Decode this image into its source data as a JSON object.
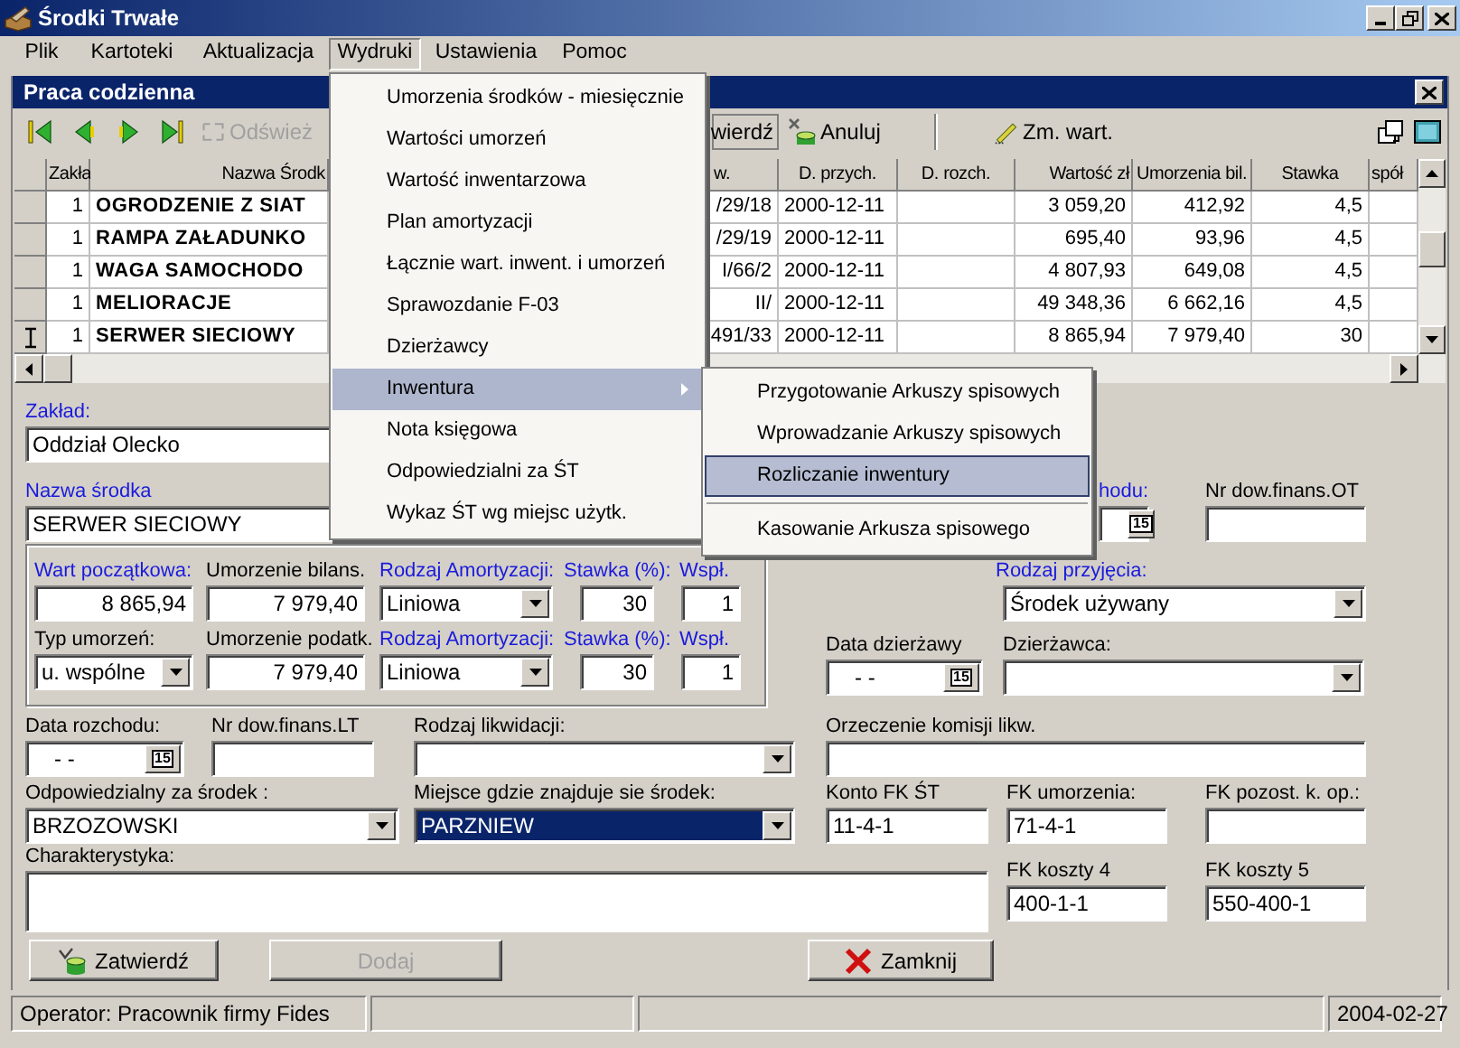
{
  "window": {
    "title": "Środki Trwałe"
  },
  "menu_bar": [
    {
      "label": "Plik",
      "selected": false
    },
    {
      "label": "Kartoteki",
      "selected": false
    },
    {
      "label": "Aktualizacja",
      "selected": false
    },
    {
      "label": "Wydruki",
      "selected": true
    },
    {
      "label": "Ustawienia",
      "selected": false
    },
    {
      "label": "Pomoc",
      "selected": false
    }
  ],
  "dropdown_menu": {
    "items": [
      {
        "label": "Umorzenia środków - miesięcznie",
        "selected": false,
        "has_submenu": false
      },
      {
        "label": "Wartości umorzeń",
        "selected": false,
        "has_submenu": false
      },
      {
        "label": "Wartość inwentarzowa",
        "selected": false,
        "has_submenu": false
      },
      {
        "label": "Plan amortyzacji",
        "selected": false,
        "has_submenu": false
      },
      {
        "label": "Łącznie wart. inwent. i umorzeń",
        "selected": false,
        "has_submenu": false
      },
      {
        "label": "Sprawozdanie F-03",
        "selected": false,
        "has_submenu": false
      },
      {
        "label": "Dzierżawcy",
        "selected": false,
        "has_submenu": false
      },
      {
        "label": "Inwentura",
        "selected": true,
        "has_submenu": true
      },
      {
        "label": "Nota księgowa",
        "selected": false,
        "has_submenu": false
      },
      {
        "label": "Odpowiedzialni za ŚT",
        "selected": false,
        "has_submenu": false
      },
      {
        "label": "Wykaz ŚT wg miejsc użytk.",
        "selected": false,
        "has_submenu": false
      }
    ]
  },
  "submenu": {
    "items": [
      {
        "kind": "item",
        "label": "Przygotowanie Arkuszy spisowych",
        "selected": false
      },
      {
        "kind": "item",
        "label": "Wprowadzanie Arkuszy spisowych",
        "selected": false
      },
      {
        "kind": "item",
        "label": "Rozliczanie inwentury",
        "selected": true
      },
      {
        "kind": "separator"
      },
      {
        "kind": "item",
        "label": "Kasowanie Arkusza spisowego",
        "selected": false
      }
    ]
  },
  "child_window": {
    "title": "Praca codzienna"
  },
  "toolbar": [
    {
      "kind": "refresh",
      "label": "Odśwież",
      "disabled": true
    },
    {
      "kind": "confirm",
      "label": "wierdź",
      "disabled": false
    },
    {
      "kind": "cancel",
      "label": "Anuluj",
      "disabled": false
    },
    {
      "kind": "edit",
      "label": "Zm. wart.",
      "disabled": false
    }
  ],
  "table": {
    "columns": [
      {
        "label": "Zakła"
      },
      {
        "label": "Nazwa Środk"
      },
      {
        "label": "w."
      },
      {
        "label": "D. przych."
      },
      {
        "label": "D. rozch."
      },
      {
        "label": "Wartość zł"
      },
      {
        "label": "Umorzenia bil."
      },
      {
        "label": "Stawka"
      },
      {
        "label": "spół"
      }
    ],
    "rows": [
      {
        "current": false,
        "zakl": "1",
        "nazwa": "OGRODZENIE Z SIAT",
        "nr": "/29/18",
        "d_przych": "2000-12-11",
        "wartosc": "3 059,20",
        "umorzenia": "412,92",
        "stawka": "4,5"
      },
      {
        "current": false,
        "zakl": "1",
        "nazwa": "RAMPA ZAŁADUNKO",
        "nr": "/29/19",
        "d_przych": "2000-12-11",
        "wartosc": "695,40",
        "umorzenia": "93,96",
        "stawka": "4,5"
      },
      {
        "current": false,
        "zakl": "1",
        "nazwa": "WAGA SAMOCHODO",
        "nr": "I/66/2",
        "d_przych": "2000-12-11",
        "wartosc": "4 807,93",
        "umorzenia": "649,08",
        "stawka": "4,5"
      },
      {
        "current": false,
        "zakl": "1",
        "nazwa": "MELIORACJE",
        "nr": "II/",
        "d_przych": "2000-12-11",
        "wartosc": "49 348,36",
        "umorzenia": "6 662,16",
        "stawka": "4,5"
      },
      {
        "current": true,
        "zakl": "1",
        "nazwa": "SERWER SIECIOWY",
        "nr": "491/33",
        "d_przych": "2000-12-11",
        "wartosc": "8 865,94",
        "umorzenia": "7 979,40",
        "stawka": "30"
      }
    ]
  },
  "form": {
    "zaklad": {
      "kind": "text",
      "label": "Zakład:",
      "required": true,
      "value": "Oddział Olecko"
    },
    "nazwa_srodka": {
      "kind": "text",
      "label": "Nazwa środka",
      "required": true,
      "value": "SERWER SIECIOWY"
    },
    "field_hodu": {
      "kind": "date",
      "label": "hodu:",
      "required": true,
      "button": "15"
    },
    "nr_dow_finans_ot": {
      "kind": "text",
      "label": "Nr dow.finans.OT",
      "required": false
    },
    "wart_poczatkowa": {
      "kind": "number",
      "label": "Wart początkowa:",
      "required": true,
      "value": "8 865,94"
    },
    "umorzenie_bilans": {
      "kind": "number",
      "label": "Umorzenie bilans.",
      "required": false,
      "value": "7 979,40"
    },
    "rodzaj_amortyzacji_1": {
      "kind": "combo",
      "label": "Rodzaj Amortyzacji:",
      "required": true,
      "value": "Liniowa",
      "focused": false
    },
    "stawka_1": {
      "kind": "number",
      "label": "Stawka (%):",
      "required": true,
      "value": "30"
    },
    "wspl_1": {
      "kind": "number",
      "label": "Wspł.",
      "required": true,
      "value": "1"
    },
    "typ_umorzen": {
      "kind": "combo",
      "label": "Typ umorzeń:",
      "required": false,
      "value": "u. wspólne",
      "focused": false
    },
    "umorzenie_podatk": {
      "kind": "number",
      "label": "Umorzenie podatk.",
      "required": false,
      "value": "7 979,40"
    },
    "rodzaj_amortyzacji_2": {
      "kind": "combo",
      "label": "Rodzaj Amortyzacji:",
      "required": true,
      "value": "Liniowa",
      "focused": false
    },
    "stawka_2": {
      "kind": "number",
      "label": "Stawka (%):",
      "required": true,
      "value": "30"
    },
    "wspl_2": {
      "kind": "number",
      "label": "Wspł.",
      "required": true,
      "value": "1"
    },
    "rodzaj_przyjecia": {
      "kind": "combo",
      "label": "Rodzaj przyjęcia:",
      "required": true,
      "value": "Środek używany",
      "focused": false
    },
    "data_dzierzawy": {
      "kind": "date",
      "label": "Data dzierżawy",
      "required": false,
      "value": "- -",
      "button": "15"
    },
    "dzierzawca": {
      "kind": "combo",
      "label": "Dzierżawca:",
      "required": false,
      "focused": false
    },
    "data_rozchodu": {
      "kind": "date",
      "label": "Data rozchodu:",
      "required": false,
      "value": "- -",
      "button": "15"
    },
    "nr_dow_finans_lt": {
      "kind": "text",
      "label": "Nr dow.finans.LT",
      "required": false
    },
    "rodzaj_likwidacji": {
      "kind": "combo",
      "label": "Rodzaj likwidacji:",
      "required": false,
      "focused": false
    },
    "orzeczenie_komisji": {
      "kind": "text",
      "label": "Orzeczenie komisji likw.",
      "required": false
    },
    "odpowiedzialny": {
      "kind": "combo",
      "label": "Odpowiedzialny za środek :",
      "required": false,
      "value": "BRZOZOWSKI",
      "focused": false
    },
    "miejsce": {
      "kind": "combo",
      "label": "Miejsce gdzie znajduje sie środek:",
      "required": false,
      "value": "PARZNIEW",
      "focused": true
    },
    "konto_fk_st": {
      "kind": "text",
      "label": "Konto FK ŚT",
      "required": false,
      "value": "11-4-1"
    },
    "fk_umorzenia": {
      "kind": "text",
      "label": "FK umorzenia:",
      "required": false,
      "value": "71-4-1"
    },
    "fk_pozost": {
      "kind": "text",
      "label": "FK pozost. k. op.:",
      "required": false
    },
    "charakterystyka": {
      "kind": "memo",
      "label": "Charakterystyka:",
      "required": false
    },
    "fk_koszty_4": {
      "kind": "text",
      "label": "FK koszty 4",
      "required": false,
      "value": "400-1-1"
    },
    "fk_koszty_5": {
      "kind": "text",
      "label": "FK koszty 5",
      "required": false,
      "value": "550-400-1"
    }
  },
  "buttons": [
    {
      "kind": "confirm",
      "label": "Zatwierdź",
      "disabled": false
    },
    {
      "kind": "add",
      "label": "Dodaj",
      "disabled": true
    },
    {
      "kind": "close",
      "label": "Zamknij",
      "disabled": false
    }
  ],
  "status_bar": {
    "operator": "Operator: Pracownik firmy Fides",
    "date": "2004-02-27"
  }
}
